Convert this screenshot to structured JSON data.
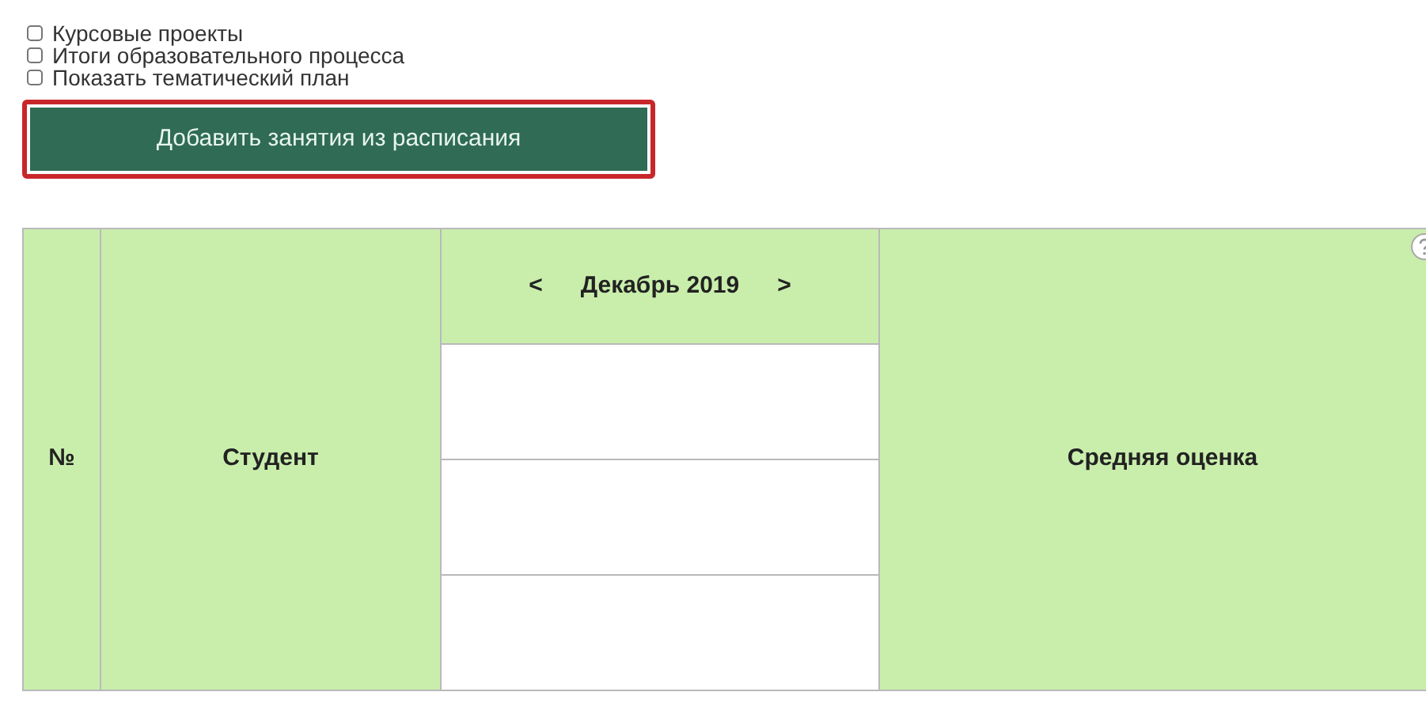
{
  "options": [
    {
      "label": "Курсовые проекты",
      "checked": false
    },
    {
      "label": "Итоги образовательного процесса",
      "checked": false
    },
    {
      "label": "Показать тематический план",
      "checked": false
    }
  ],
  "add_button": {
    "label": "Добавить занятия из расписания",
    "highlighted": true
  },
  "table": {
    "columns": [
      "№",
      "Студент",
      "Средняя оценка"
    ],
    "month": {
      "prev": "<",
      "label": "Декабрь 2019",
      "next": ">"
    }
  }
}
